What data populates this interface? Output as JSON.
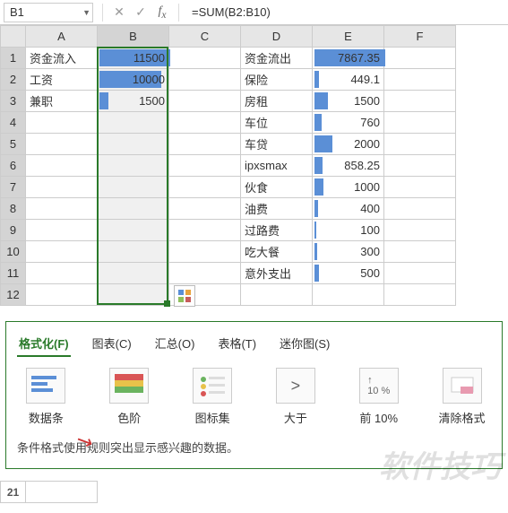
{
  "name_box": "B1",
  "formula": "=SUM(B2:B10)",
  "columns": [
    "A",
    "B",
    "C",
    "D",
    "E",
    "F"
  ],
  "row_count": 12,
  "selected_col_idx": 1,
  "col_b_max": 11500,
  "col_e_max": 7867.35,
  "rows": [
    {
      "A": "资金流入",
      "B": 11500,
      "D": "资金流出",
      "E": 7867.35
    },
    {
      "A": "工资",
      "B": 10000,
      "D": "保险",
      "E": 449.1
    },
    {
      "A": "兼职",
      "B": 1500,
      "D": "房租",
      "E": 1500
    },
    {
      "D": "车位",
      "E": 760
    },
    {
      "D": "车贷",
      "E": 2000
    },
    {
      "D": "ipxsmax",
      "E": 858.25
    },
    {
      "D": "伙食",
      "E": 1000
    },
    {
      "D": "油费",
      "E": 400
    },
    {
      "D": "过路费",
      "E": 100
    },
    {
      "D": "吃大餐",
      "E": 300
    },
    {
      "D": "意外支出",
      "E": 500
    },
    {}
  ],
  "popup": {
    "tabs": [
      {
        "label": "格式化(F)",
        "active": true
      },
      {
        "label": "图表(C)"
      },
      {
        "label": "汇总(O)"
      },
      {
        "label": "表格(T)"
      },
      {
        "label": "迷你图(S)"
      }
    ],
    "options": [
      {
        "label": "数据条",
        "key": "databar"
      },
      {
        "label": "色阶",
        "key": "colorscale"
      },
      {
        "label": "图标集",
        "key": "iconset"
      },
      {
        "label": "大于",
        "key": "greater"
      },
      {
        "label": "前 10%",
        "key": "top10"
      },
      {
        "label": "清除格式",
        "key": "clear"
      }
    ],
    "description": "条件格式使用规则突出显示感兴趣的数据。"
  },
  "watermark": "软件技巧",
  "bottom_row": 21
}
